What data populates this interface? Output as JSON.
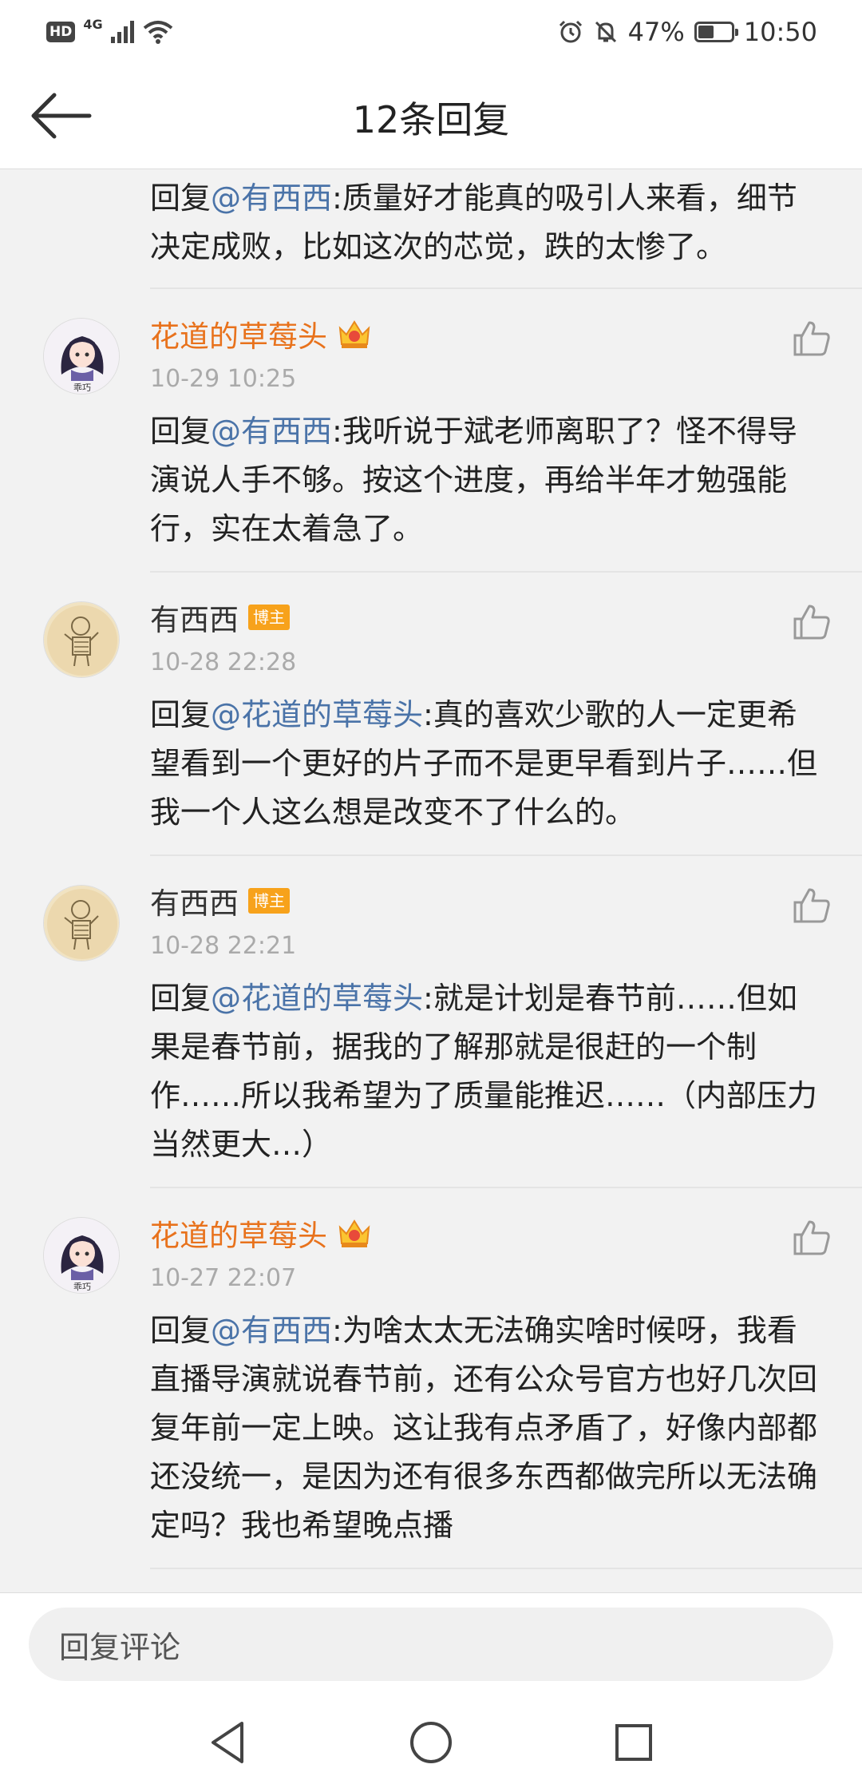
{
  "status_bar": {
    "network_badge": "HD",
    "network_type": "4G",
    "battery_percent": "47%",
    "battery_level": 0.47,
    "time": "10:50"
  },
  "header": {
    "title": "12条回复"
  },
  "top_partial": {
    "prefix": "回复",
    "mention": "@有西西",
    "text": ":质量好才能真的吸引人来看，细节决定成败，比如这次的芯觉，跌的太惨了。"
  },
  "comments": [
    {
      "user": "花道的草莓头",
      "vip": true,
      "badge": "",
      "time": "10-29 10:25",
      "prefix": "回复",
      "mention": "@有西西",
      "text": ":我听说于斌老师离职了？怪不得导演说人手不够。按这个进度，再给半年才勉强能行，实在太着急了。",
      "avatar_label": "乖巧"
    },
    {
      "user": "有西西",
      "vip": false,
      "badge": "博主",
      "time": "10-28 22:28",
      "prefix": "回复",
      "mention": "@花道的草莓头",
      "text": ":真的喜欢少歌的人一定更希望看到一个更好的片子而不是更早看到片子……但我一个人这么想是改变不了什么的。"
    },
    {
      "user": "有西西",
      "vip": false,
      "badge": "博主",
      "time": "10-28 22:21",
      "prefix": "回复",
      "mention": "@花道的草莓头",
      "text": ":就是计划是春节前……但如果是春节前，据我的了解那就是很赶的一个制作……所以我希望为了质量能推迟……（内部压力当然更大…）"
    },
    {
      "user": "花道的草莓头",
      "vip": true,
      "badge": "",
      "time": "10-27 22:07",
      "prefix": "回复",
      "mention": "@有西西",
      "text": ":为啥太太无法确实啥时候呀，我看直播导演就说春节前，还有公众号官方也好几次回复年前一定上映。这让我有点矛盾了，好像内部都还没统一，是因为还有很多东西都做完所以无法确定吗？我也希望晚点播",
      "avatar_label": "乖巧"
    }
  ],
  "reply_bar": {
    "placeholder": "回复评论"
  },
  "colors": {
    "mention": "#4a73a8",
    "vip_name": "#e8721c",
    "blogger_badge": "#f7a21b",
    "time": "#aaaaaa"
  },
  "icons": [
    "back-arrow-icon",
    "like-icon",
    "crown-icon",
    "nav-back-icon",
    "nav-home-icon",
    "nav-recents-icon"
  ]
}
